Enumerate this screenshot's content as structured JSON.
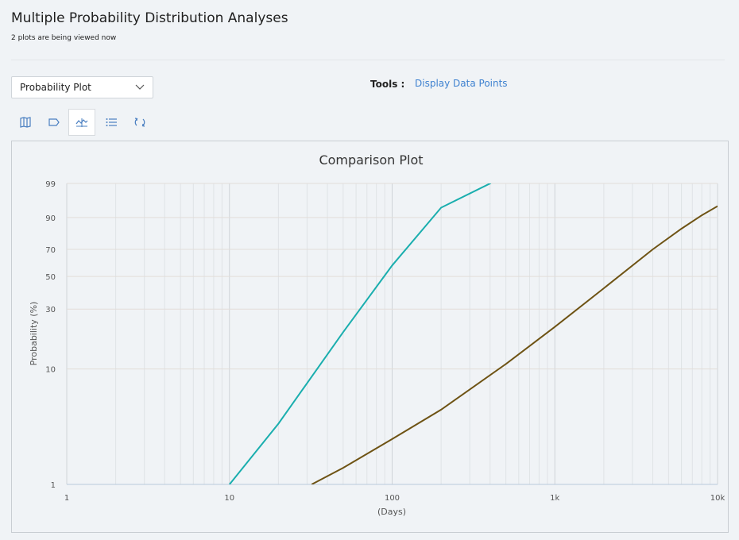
{
  "header": {
    "title": "Multiple Probability Distribution Analyses",
    "subtitle": "2 plots are being viewed now"
  },
  "toolbar": {
    "plot_select_value": "Probability Plot",
    "tools_label": "Tools :",
    "display_data_points": "Display Data Points",
    "icons": [
      "map-icon",
      "tag-icon",
      "line-chart-icon",
      "list-icon",
      "refresh-icon"
    ],
    "active_icon": "line-chart-icon"
  },
  "colors": {
    "accent_link": "#3f82d0",
    "series_1": "#1aaeae",
    "series_2": "#6e5314"
  },
  "chart_data": {
    "type": "line",
    "title": "Comparison Plot",
    "xlabel": "(Days)",
    "ylabel": "Probability (%)",
    "x_scale": "log",
    "y_scale": "weibull-probability",
    "xlim": [
      1,
      10000
    ],
    "ylim": [
      1,
      99
    ],
    "x_ticks": [
      1,
      10,
      100,
      1000,
      10000
    ],
    "x_tick_labels": [
      "1",
      "10",
      "100",
      "1k",
      "10k"
    ],
    "y_ticks": [
      1,
      10,
      30,
      50,
      70,
      90,
      99
    ],
    "y_tick_labels": [
      "1",
      "10",
      "30",
      "50",
      "70",
      "90",
      "99"
    ],
    "grid": true,
    "series": [
      {
        "color": "#1aaeae",
        "x": [
          10,
          20,
          50,
          100,
          200,
          400,
          540
        ],
        "y": [
          1,
          3.4,
          20,
          58,
          94,
          99.0,
          99.9
        ]
      },
      {
        "color": "#6e5314",
        "x": [
          32,
          50,
          100,
          200,
          500,
          1000,
          2000,
          4000,
          6000,
          8000,
          10000
        ],
        "y": [
          1,
          1.4,
          2.5,
          4.5,
          11,
          22,
          42,
          70,
          84,
          91,
          94.5
        ]
      }
    ]
  }
}
